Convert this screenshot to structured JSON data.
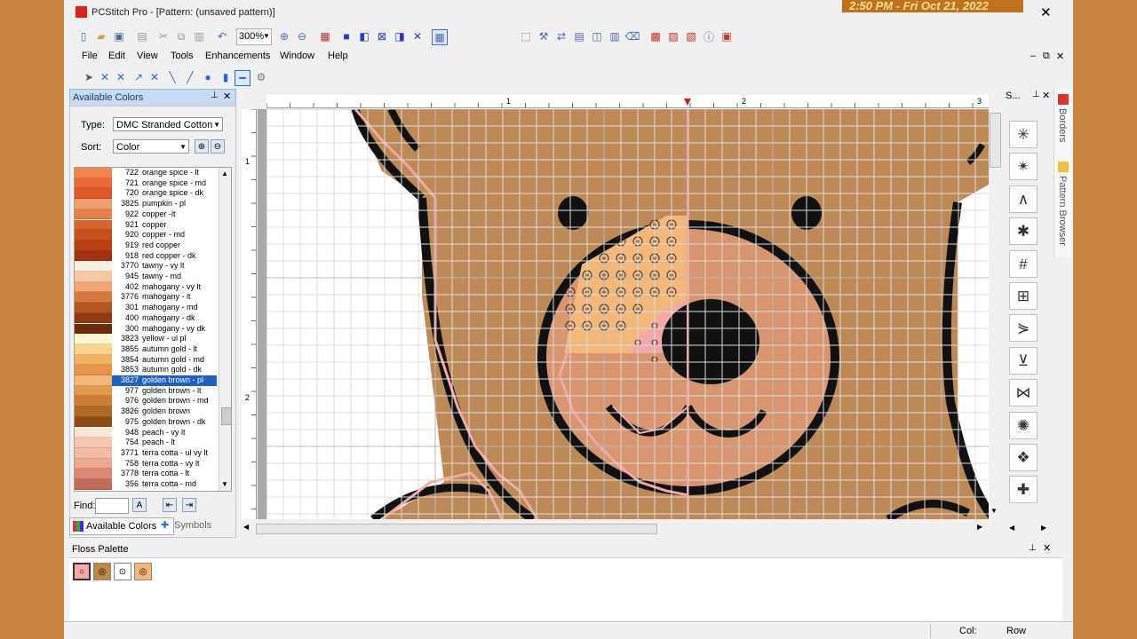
{
  "window": {
    "title": "PCStitch Pro - [Pattern: (unsaved pattern)]",
    "clock": "2:50 PM - Fri Oct 21, 2022",
    "close_glyph": "✕"
  },
  "toolbar": {
    "zoom": "300%"
  },
  "menu": [
    "File",
    "Edit",
    "View",
    "Tools",
    "Enhancements",
    "Window",
    "Help"
  ],
  "mdi_controls": [
    "–",
    "⧉",
    "✕"
  ],
  "available_colors": {
    "panel_title": "Available Colors",
    "type_label": "Type:",
    "type_value": "DMC Stranded Cotton",
    "sort_label": "Sort:",
    "sort_value": "Color",
    "find_label": "Find:",
    "rows": [
      {
        "num": "722",
        "name": "orange spice - lt",
        "color": "#f0844e"
      },
      {
        "num": "721",
        "name": "orange spice - md",
        "color": "#ec6a3a"
      },
      {
        "num": "720",
        "name": "orange spice - dk",
        "color": "#e05a28"
      },
      {
        "num": "3825",
        "name": "pumpkin - pl",
        "color": "#f0a070"
      },
      {
        "num": "922",
        "name": "copper -lt",
        "color": "#e5804a"
      },
      {
        "num": "921",
        "name": "copper",
        "color": "#d9652e"
      },
      {
        "num": "920",
        "name": "copper - md",
        "color": "#c84f1e"
      },
      {
        "num": "919",
        "name": "red copper",
        "color": "#b83e16"
      },
      {
        "num": "918",
        "name": "red copper - dk",
        "color": "#a03212"
      },
      {
        "num": "3770",
        "name": "tawny - vy lt",
        "color": "#fbeee0"
      },
      {
        "num": "945",
        "name": "tawny - md",
        "color": "#f6c8a4"
      },
      {
        "num": "402",
        "name": "mahogany - vy lt",
        "color": "#f0a676"
      },
      {
        "num": "3776",
        "name": "mahogany - lt",
        "color": "#d5783e"
      },
      {
        "num": "301",
        "name": "mahogany - md",
        "color": "#b65524"
      },
      {
        "num": "400",
        "name": "mahogany - dk",
        "color": "#8e3a12"
      },
      {
        "num": "300",
        "name": "mahogany - vy dk",
        "color": "#6e2a0c"
      },
      {
        "num": "3823",
        "name": "yellow - ul pl",
        "color": "#fff6d0"
      },
      {
        "num": "3855",
        "name": "autumn gold - lt",
        "color": "#fad28c"
      },
      {
        "num": "3854",
        "name": "autumn gold - md",
        "color": "#f0b260"
      },
      {
        "num": "3853",
        "name": "autumn gold - dk",
        "color": "#e8944a"
      },
      {
        "num": "3827",
        "name": "golden brown - pl",
        "color": "#f5b878",
        "selected": true
      },
      {
        "num": "977",
        "name": "golden brown - lt",
        "color": "#e09a4e"
      },
      {
        "num": "976",
        "name": "golden brown - md",
        "color": "#cc7e34"
      },
      {
        "num": "3826",
        "name": "golden brown",
        "color": "#b06a28"
      },
      {
        "num": "975",
        "name": "golden brown - dk",
        "color": "#8e4a16"
      },
      {
        "num": "948",
        "name": "peach - vy lt",
        "color": "#fde6d8"
      },
      {
        "num": "754",
        "name": "peach - lt",
        "color": "#f7c6b0"
      },
      {
        "num": "3771",
        "name": "terra cotta - ul vy lt",
        "color": "#f4bca6"
      },
      {
        "num": "758",
        "name": "terra cotta - vy lt",
        "color": "#eea88e"
      },
      {
        "num": "3778",
        "name": "terra cotta - lt",
        "color": "#d88874"
      },
      {
        "num": "356",
        "name": "terra cotta - md",
        "color": "#c46a58"
      }
    ],
    "tabs": [
      "Available Colors",
      "Symbols"
    ]
  },
  "ruler": {
    "top_labels": [
      "1",
      "2",
      "3"
    ],
    "left_labels": [
      "1",
      "2"
    ]
  },
  "stitch_panel": {
    "title": "S...",
    "icons": [
      "star-stitch-icon",
      "eyelet-stitch-icon",
      "angle-stitch-icon",
      "asterisk-stitch-icon",
      "hash-stitch-icon",
      "grid-stitch-icon",
      "leaf-stitch-icon",
      "fish-stitch-icon",
      "bow-stitch-icon",
      "fan-stitch-icon",
      "diamond-stitch-icon",
      "cross-stitch-icon"
    ]
  },
  "side_tabs": [
    "Borders",
    "Pattern Browser"
  ],
  "floss_palette": {
    "title": "Floss Palette",
    "swatches": [
      {
        "color": "#f4a8a8",
        "symbol": "○"
      },
      {
        "color": "#c08848",
        "symbol": "◎"
      },
      {
        "color": "#ffffff",
        "symbol": "⊙"
      },
      {
        "color": "#f5b878",
        "symbol": "◎"
      }
    ]
  },
  "status": {
    "col": "Col:",
    "row": "Row"
  },
  "colors": {
    "frame": "#c8833f",
    "bear": "#bd8a57",
    "muzzle": "#d79570",
    "pink": "#f2a8a8",
    "gold_stitch": "#f2b77a",
    "selection": "#1f5fc6"
  }
}
